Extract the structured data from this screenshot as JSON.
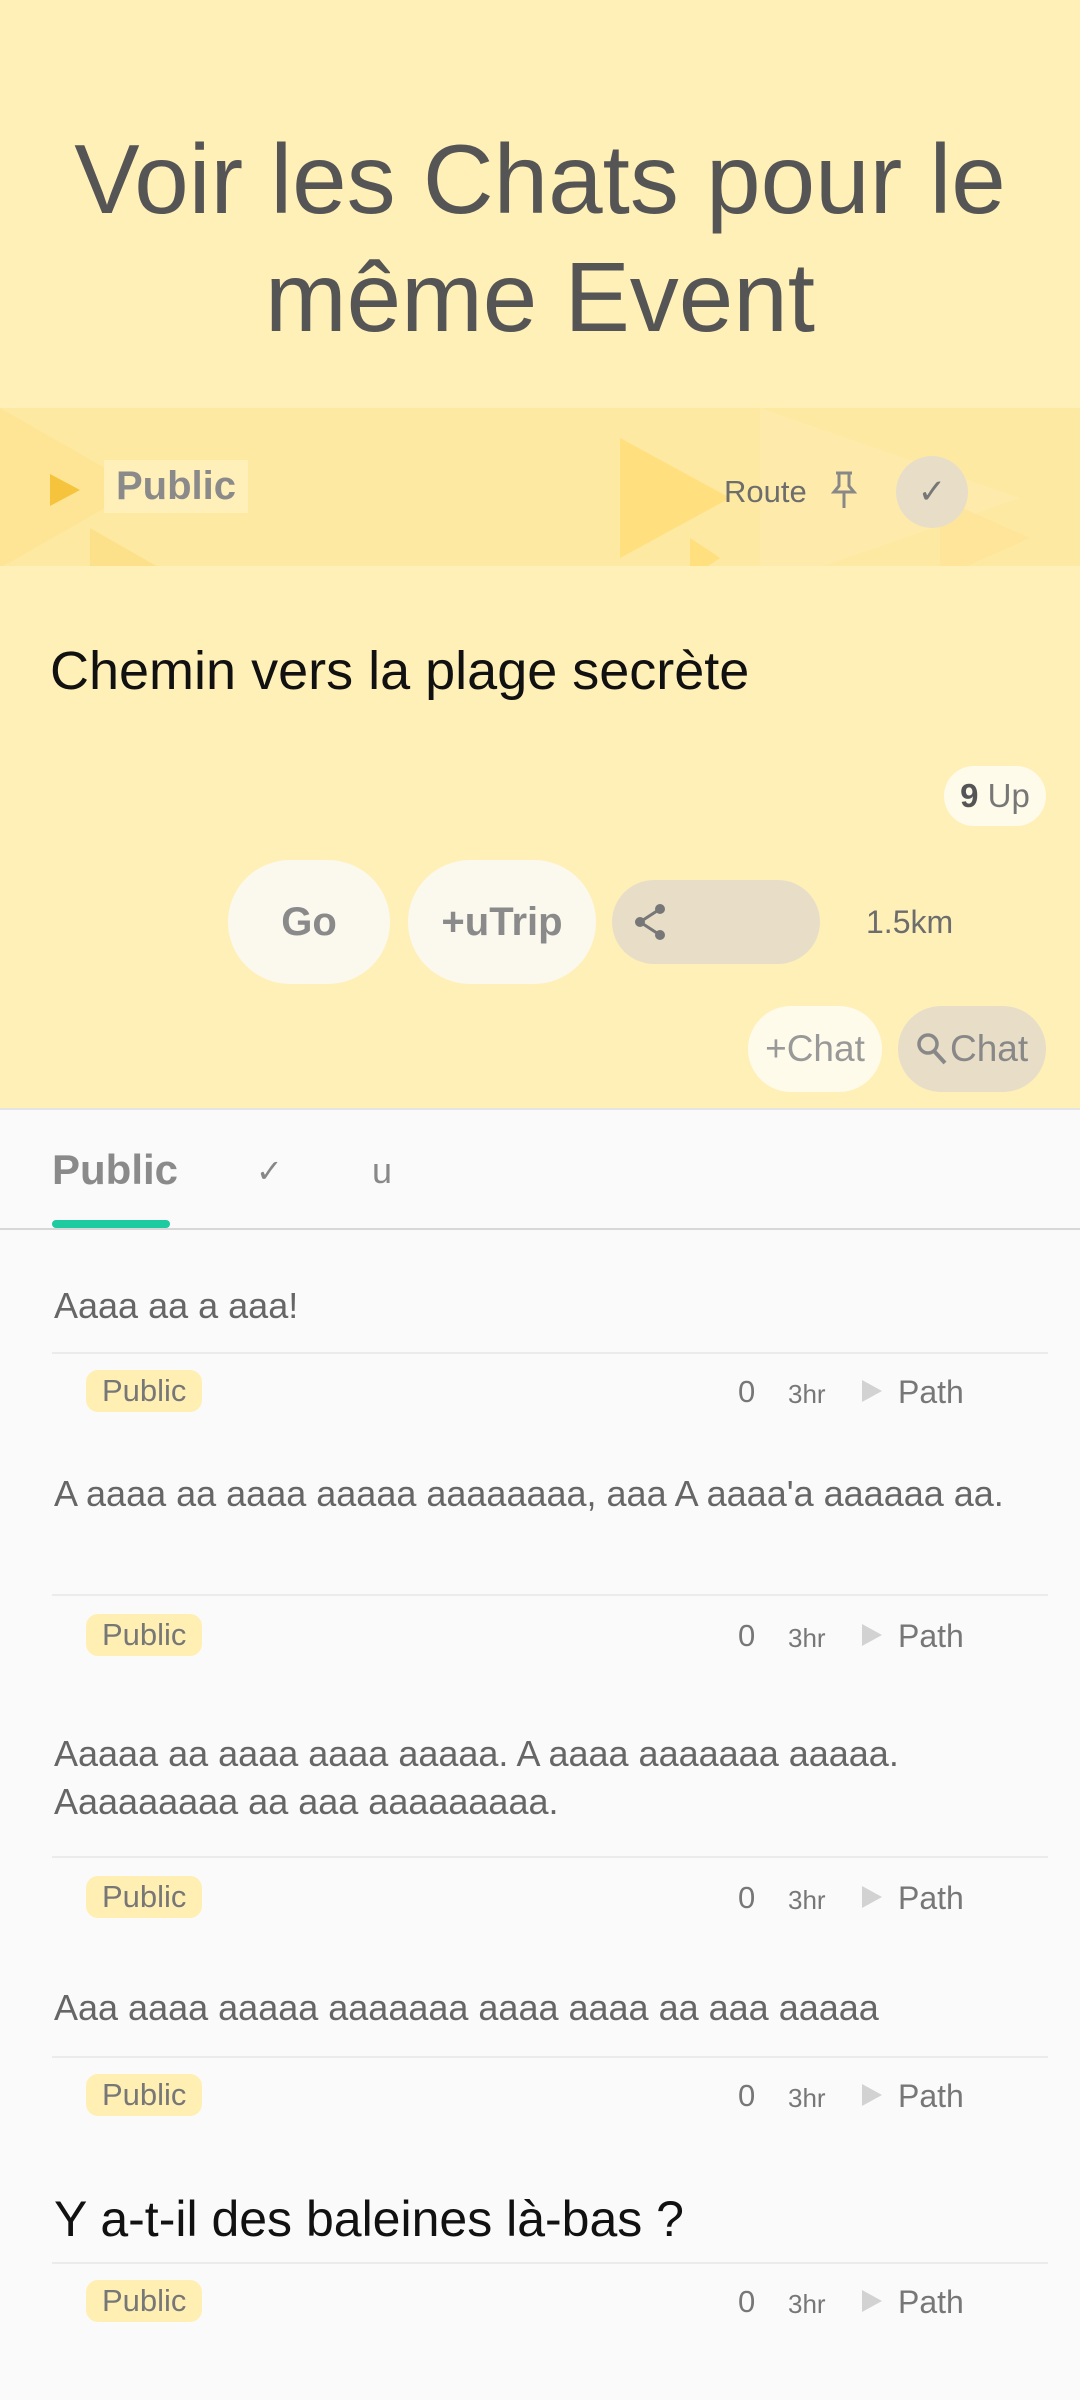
{
  "hero": {
    "title": "Voir les Chats pour le même Event"
  },
  "banner": {
    "visibility_label": "Public",
    "route_label": "Route"
  },
  "event": {
    "title": "Chemin vers la plage secrète",
    "up_count": "9",
    "up_label": "Up",
    "go_label": "Go",
    "utrip_label": "+uTrip",
    "distance": "1.5km",
    "add_chat_label": "+Chat",
    "search_chat_label": "Chat"
  },
  "tabs": [
    {
      "label": "Public"
    },
    {
      "label": "✓"
    },
    {
      "label": "u"
    }
  ],
  "posts": [
    {
      "text": "Aaaa aa a aaa!",
      "visibility": "Public",
      "count": "0",
      "time": "3hr",
      "path": "Path"
    },
    {
      "text": "A aaaa aa aaaa aaaaa aaaaaaaa, aaa A aaaa'a aaaaaa aa.",
      "visibility": "Public",
      "count": "0",
      "time": "3hr",
      "path": "Path"
    },
    {
      "text": "Aaaaa aa aaaa aaaa aaaaa. A aaaa aaaaaaa aaaaa. Aaaaaaaaa aa aaa aaaaaaaaa.",
      "visibility": "Public",
      "count": "0",
      "time": "3hr",
      "path": "Path"
    },
    {
      "text": "Aaa aaaa aaaaa aaaaaaa aaaa aaaa aa aaa aaaaa",
      "visibility": "Public",
      "count": "0",
      "time": "3hr",
      "path": "Path"
    },
    {
      "text": "Y a-t-il des baleines là-bas ?",
      "visibility": "Public",
      "count": "0",
      "time": "3hr",
      "path": "Path"
    }
  ],
  "colors": {
    "header_bg": "#FFF0B8",
    "accent": "#1ECBA0",
    "chip_bg": "#FFEFB3",
    "play": "#F6C33C"
  }
}
